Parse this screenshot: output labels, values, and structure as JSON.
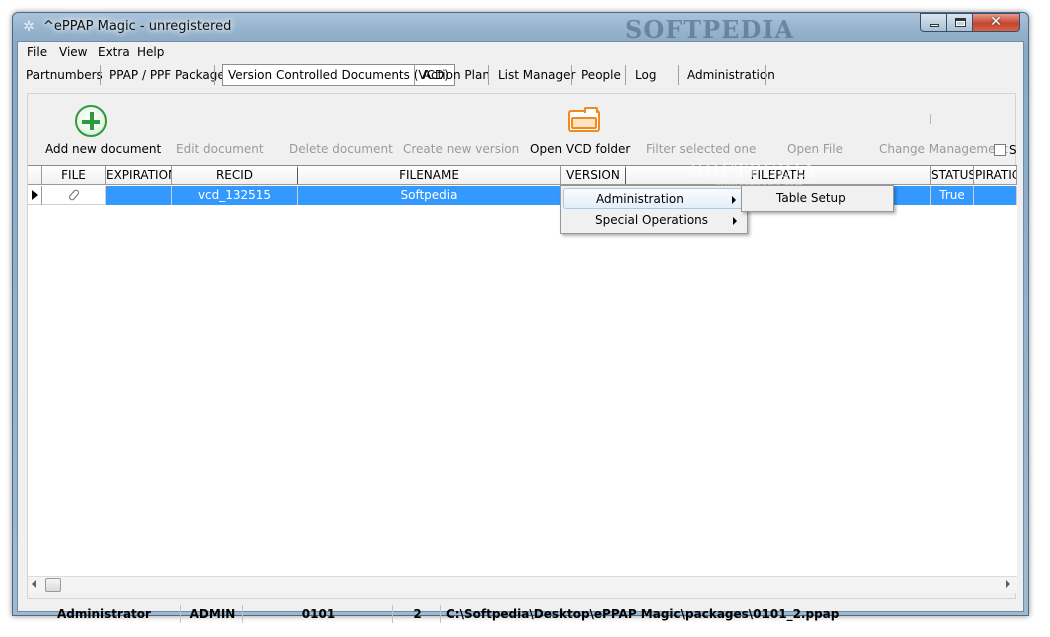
{
  "window": {
    "title": "^ePPAP Magic - unregistered",
    "watermark": "SOFTPEDIA",
    "close_glyph": "✕"
  },
  "menu": [
    "File",
    "View",
    "Extra",
    "Help"
  ],
  "tabs": [
    {
      "label": "Partnumbers"
    },
    {
      "label": "PPAP / PPF Package"
    },
    {
      "label": "Version Controlled Documents (VCD)",
      "active": true
    },
    {
      "label": "Action Plan"
    },
    {
      "label": "List Manager"
    },
    {
      "label": "People"
    },
    {
      "label": "Log"
    },
    {
      "label": "Administration"
    }
  ],
  "toolbar": {
    "add_label": "Add new document",
    "edit_label": "Edit document",
    "delete_label": "Delete document",
    "create_version_label": "Create new version",
    "open_folder_label": "Open VCD folder",
    "filter_label": "Filter selected one",
    "open_file_label": "Open File",
    "change_mgmt_label": "Change Management",
    "show_label": "Sh"
  },
  "grid": {
    "columns": [
      "FILE",
      "EXPIRATION",
      "RECID",
      "FILENAME",
      "VERSION",
      "FILEPATH",
      "STATUS",
      "PIRATIC"
    ],
    "rows": [
      {
        "file": "",
        "expiration": "",
        "recid": "vcd_132515",
        "filename": "Softpedia",
        "version": "",
        "filepath": "",
        "status": "True",
        "expiration2": ""
      }
    ],
    "watermark": "SOFTPEDIA",
    "watermark_url": "www.softpedia.com"
  },
  "context_menu": {
    "items": [
      {
        "label": "Administration",
        "highlighted": true
      },
      {
        "label": "Special Operations"
      }
    ],
    "submenu": [
      {
        "label": "Table Setup"
      }
    ]
  },
  "statusbar": {
    "user": "Administrator",
    "role": "ADMIN",
    "part": "0101",
    "revision": "2",
    "path": "C:\\Softpedia\\Desktop\\ePPAP Magic\\packages\\0101_2.ppap"
  },
  "colors": {
    "selection": "#3399ff",
    "add_icon": "#2f9a3c",
    "folder_icon": "#f08a1c"
  },
  "icons": [
    "gear-app-icon",
    "add-icon",
    "folder-icon",
    "paperclip-icon",
    "row-indicator-icon",
    "submenu-arrow-icon"
  ]
}
